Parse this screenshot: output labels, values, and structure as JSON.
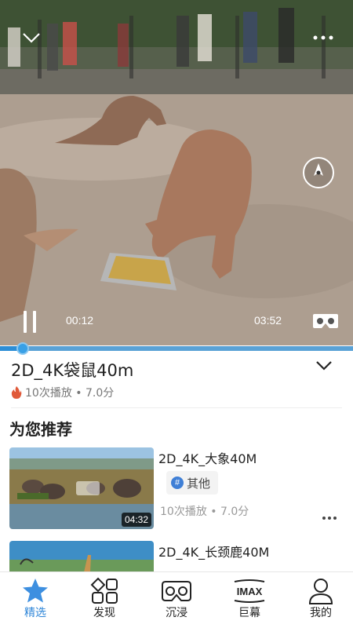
{
  "player": {
    "current_time": "00:12",
    "total_time": "03:52",
    "progress_fraction": 0.065
  },
  "video": {
    "title": "2D_4K袋鼠40m",
    "meta": "10次播放 • 7.0分"
  },
  "recommend": {
    "section_title": "为您推荐",
    "items": [
      {
        "title": "2D_4K_大象40M",
        "tag": "其他",
        "meta": "10次播放 • 7.0分",
        "duration": "04:32"
      },
      {
        "title": "2D_4K_长颈鹿40M"
      }
    ]
  },
  "tabbar": {
    "items": [
      {
        "label": "精选",
        "icon": "star-icon",
        "active": true
      },
      {
        "label": "发现",
        "icon": "grid-icon"
      },
      {
        "label": "沉浸",
        "icon": "vr-headset-icon"
      },
      {
        "label": "巨幕",
        "icon": "imax-icon",
        "icon_text": "IMAX"
      },
      {
        "label": "我的",
        "icon": "person-icon"
      }
    ]
  },
  "colors": {
    "accent": "#2f86d8",
    "progress": "#2d8ed6"
  }
}
